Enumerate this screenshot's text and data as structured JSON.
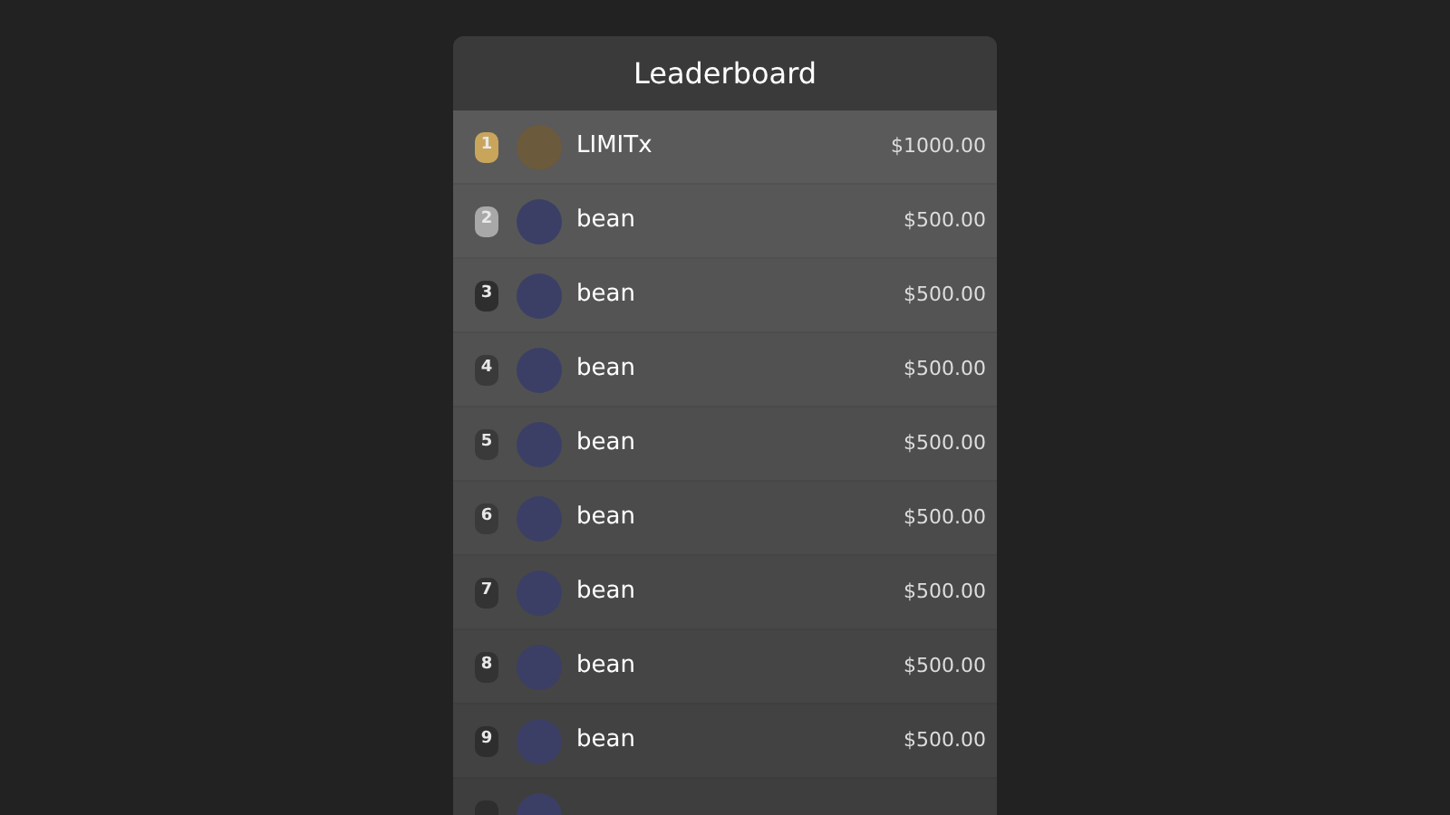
{
  "title": "Leaderboard",
  "rows": [
    {
      "rank": "1",
      "color": "#c9a55c",
      "name": "LIMITx",
      "amount": "$1000.00"
    },
    {
      "rank": "2",
      "color": "#a8a8a8",
      "name": "bean",
      "amount": "$500.00"
    },
    {
      "rank": "3",
      "color": "#2e2e2e",
      "name": "bean",
      "amount": "$500.00"
    },
    {
      "rank": "4",
      "color": "#3a3a3a",
      "name": "bean",
      "amount": "$500.00"
    },
    {
      "rank": "5",
      "color": "#3a3a3a",
      "name": "bean",
      "amount": "$500.00"
    },
    {
      "rank": "6",
      "color": "#3a3a3a",
      "name": "bean",
      "amount": "$500.00"
    },
    {
      "rank": "7",
      "color": "#333333",
      "name": "bean",
      "amount": "$500.00"
    },
    {
      "rank": "8",
      "color": "#333333",
      "name": "bean",
      "amount": "$500.00"
    },
    {
      "rank": "9",
      "color": "#2e2e2e",
      "name": "bean",
      "amount": "$500.00"
    }
  ]
}
